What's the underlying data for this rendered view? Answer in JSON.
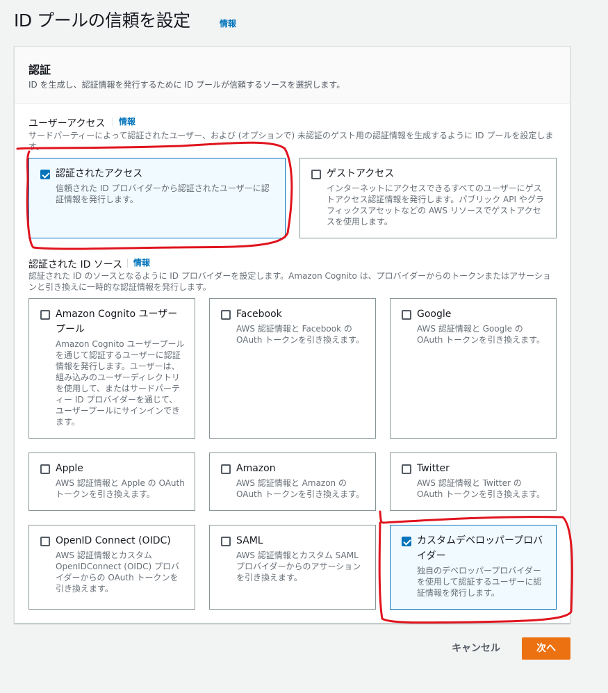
{
  "page": {
    "title": "ID プールの信頼を設定",
    "info_link": "情報"
  },
  "auth_section": {
    "title": "認証",
    "description": "ID を生成し、認証情報を発行するために ID プールが信頼するソースを選択します。"
  },
  "user_access": {
    "label": "ユーザーアクセス",
    "info_link": "情報",
    "description": "サードパーティーによって認証されたユーザー、および (オプションで) 未認証のゲスト用の認証情報を生成するように ID プールを設定します。",
    "options": [
      {
        "label": "認証されたアクセス",
        "description": "信頼された ID プロバイダーから認証されたユーザーに認証情報を発行します。",
        "checked": true
      },
      {
        "label": "ゲストアクセス",
        "description": "インターネットにアクセスできるすべてのユーザーにゲストアクセス認証情報を発行します。パブリック API やグラフィックスアセットなどの AWS リソースでゲストアクセスを使用します。",
        "checked": false
      }
    ]
  },
  "id_sources": {
    "label": "認証された ID ソース",
    "info_link": "情報",
    "description": "認証された ID のソースとなるように ID プロバイダーを設定します。Amazon Cognito は、プロバイダーからのトークンまたはアサーションと引き換えに一時的な認証情報を発行します。",
    "options": [
      {
        "label": "Amazon Cognito ユーザープール",
        "description": "Amazon Cognito ユーザープールを通じて認証するユーザーに認証情報を発行します。ユーザーは、組み込みのユーザーディレクトリを使用して、またはサードパーティー ID プロバイダーを通じて、ユーザープールにサインインできます。",
        "checked": false
      },
      {
        "label": "Facebook",
        "description": "AWS 認証情報と Facebook の OAuth トークンを引き換えます。",
        "checked": false
      },
      {
        "label": "Google",
        "description": "AWS 認証情報と Google の OAuth トークンを引き換えます。",
        "checked": false
      },
      {
        "label": "Apple",
        "description": "AWS 認証情報と Apple の OAuth トークンを引き換えます。",
        "checked": false
      },
      {
        "label": "Amazon",
        "description": "AWS 認証情報と Amazon の OAuth トークンを引き換えます。",
        "checked": false
      },
      {
        "label": "Twitter",
        "description": "AWS 認証情報と Twitter の OAuth トークンを引き換えます。",
        "checked": false
      },
      {
        "label": "OpenID Connect (OIDC)",
        "description": "AWS 認証情報とカスタム OpenIDConnect (OIDC) プロバイダーからの OAuth トークンを引き換えます。",
        "checked": false
      },
      {
        "label": "SAML",
        "description": "AWS 認証情報とカスタム SAML プロバイダーからのアサーションを引き換えます。",
        "checked": false
      },
      {
        "label": "カスタムデベロッパープロバイダー",
        "description": "独自のデベロッパープロバイダーを使用して認証するユーザーに認証情報を発行します。",
        "checked": true
      }
    ]
  },
  "footer": {
    "cancel_label": "キャンセル",
    "next_label": "次へ"
  },
  "colors": {
    "link": "#0073bb",
    "primary_button": "#ec7211",
    "selected_tile_bg": "#f1faff",
    "annotation": "#e0141e"
  }
}
